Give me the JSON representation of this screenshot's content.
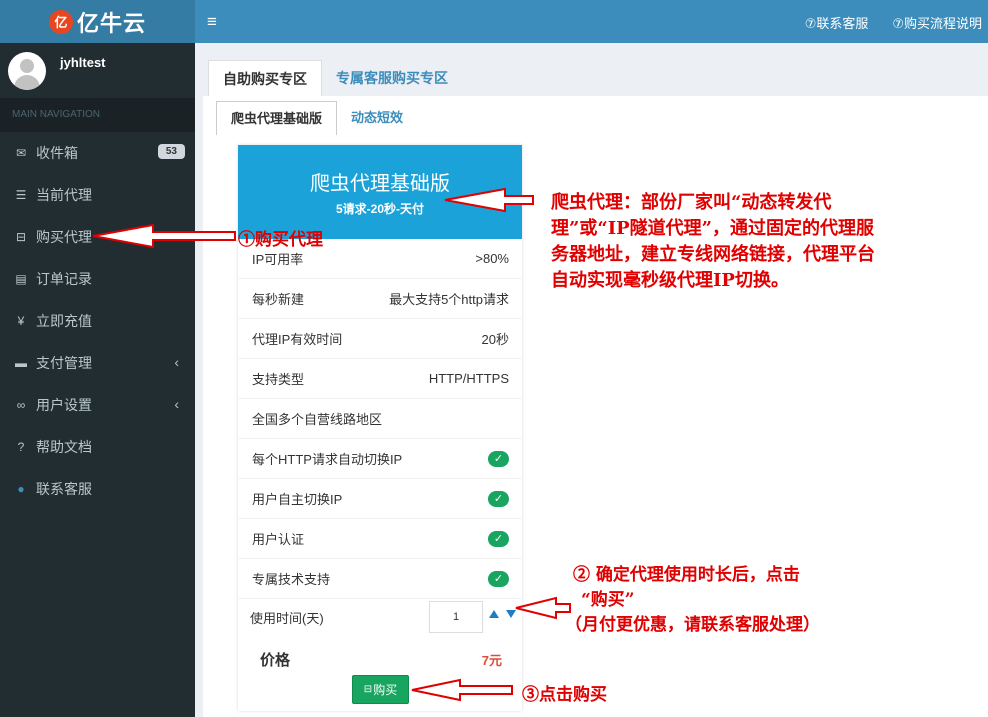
{
  "header": {
    "logo_mark": "亿",
    "logo_text": "亿牛云",
    "menu_icon": "≡",
    "nav": [
      "⑦联系客服",
      "⑦购买流程说明"
    ]
  },
  "sidebar": {
    "username": "jyhltest",
    "section_header": "MAIN NAVIGATION",
    "items": [
      {
        "label": "收件箱",
        "icon": "envelope-icon",
        "glyph": "✉",
        "badge": "53"
      },
      {
        "label": "当前代理",
        "icon": "list-icon",
        "glyph": "☰"
      },
      {
        "label": "购买代理",
        "icon": "cart-icon",
        "glyph": "⊟"
      },
      {
        "label": "订单记录",
        "icon": "table-icon",
        "glyph": "▤"
      },
      {
        "label": "立即充值",
        "icon": "yen-icon",
        "glyph": "¥"
      },
      {
        "label": "支付管理",
        "icon": "credit-card-icon",
        "glyph": "▬",
        "chevron": "‹"
      },
      {
        "label": "用户设置",
        "icon": "link-icon",
        "glyph": "∞",
        "chevron": "‹"
      },
      {
        "label": "帮助文档",
        "icon": "question-icon",
        "glyph": "?"
      },
      {
        "label": "联系客服",
        "icon": "user-icon",
        "glyph": "●"
      }
    ]
  },
  "tabs": {
    "primary": [
      "自助购买专区",
      "专属客服购买专区"
    ],
    "secondary": [
      "爬虫代理基础版",
      "动态短效"
    ]
  },
  "product": {
    "title": "爬虫代理基础版",
    "subtitle": "5请求-20秒-天付",
    "specs": [
      {
        "label": "IP可用率",
        "value": ">80%"
      },
      {
        "label": "每秒新建",
        "value": "最大支持5个http请求"
      },
      {
        "label": "代理IP有效时间",
        "value": "20秒"
      },
      {
        "label": "支持类型",
        "value": "HTTP/HTTPS"
      },
      {
        "label": "全国多个自营线路地区",
        "value": ""
      }
    ],
    "features": [
      "每个HTTP请求自动切换IP",
      "用户自主切换IP",
      "用户认证",
      "专属技术支持"
    ],
    "duration_label": "使用时间(天)",
    "duration_value": "1",
    "price_label": "价格",
    "price_value": "7元",
    "buy_label": "购买",
    "buy_icon": "cart-icon"
  },
  "annotations": {
    "step1": "①购买代理",
    "note": "爬虫代理：部份厂家叫“动态转发代理”或“IP隧道代理”，通过固定的代理服务器地址，建立专线网络链接，代理平台自动实现毫秒级代理IP切换。",
    "step2_line1": "② 确定代理使用时长后，点击",
    "step2_line2": "“购买”",
    "step2_line3": "（月付更优惠，请联系客服处理）",
    "step3": "③点击购买"
  },
  "colors": {
    "header": "#3c8dbc",
    "sidebar": "#222d32",
    "card_head": "#1ba3d9",
    "check": "#17a55f",
    "price": "#dd4b39",
    "annotation": "#e00000"
  }
}
